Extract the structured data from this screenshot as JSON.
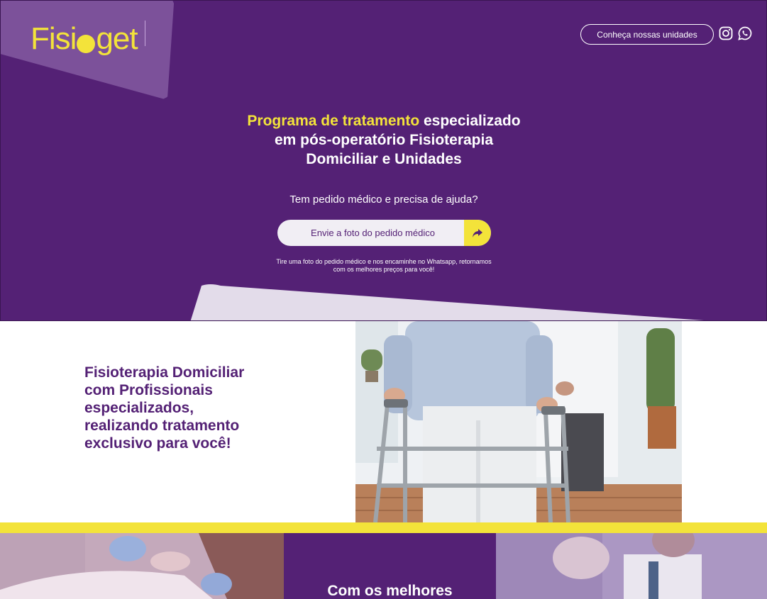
{
  "header": {
    "logo_text_a": "Fisi",
    "logo_text_b": "get",
    "units_button": "Conheça nossas unidades",
    "icons": [
      "instagram-icon",
      "whatsapp-icon"
    ]
  },
  "hero": {
    "headline_highlight": "Programa de tratamento",
    "headline_rest_1": " especializado",
    "headline_line_2": "em pós-operatório Fisioterapia",
    "headline_line_3": "Domiciliar e Unidades",
    "question": "Tem pedido médico e precisa de ajuda?",
    "cta_label": "Envie a foto do pedido médico",
    "note_line_1": "Tire uma foto do pedido médico e nos encaminhe no Whatsapp, retornamos",
    "note_line_2": "com os melhores preços para você!"
  },
  "section2": {
    "title_lines": [
      "Fisioterapia Domiciliar",
      "com Profissionais",
      "especializados,",
      "realizando tratamento",
      "exclusivo para você!"
    ]
  },
  "section3": {
    "title": "Com os melhores"
  },
  "colors": {
    "brand_purple": "#542175",
    "brand_yellow": "#f3e33a",
    "light_lavender": "#e3dcea"
  }
}
